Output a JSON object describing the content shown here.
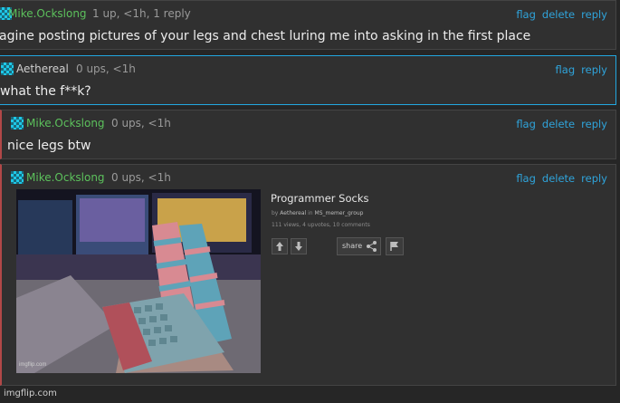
{
  "comments": [
    {
      "user": "Mike.Ockslong",
      "meta": "1 up, <1h, 1 reply",
      "actions": [
        "flag",
        "delete",
        "reply"
      ],
      "text": "agine posting pictures of your legs and chest luring me into asking in the first place"
    },
    {
      "user": "Aethereal",
      "meta": "0 ups, <1h",
      "actions": [
        "flag",
        "reply"
      ],
      "text": "what the f**k?"
    },
    {
      "user": "Mike.Ockslong",
      "meta": "0 ups, <1h",
      "actions": [
        "flag",
        "delete",
        "reply"
      ],
      "text": "nice legs btw"
    },
    {
      "user": "Mike.Ockslong",
      "meta": "0 ups, <1h",
      "actions": [
        "flag",
        "delete",
        "reply"
      ]
    }
  ],
  "embed": {
    "title": "Programmer Socks",
    "by_prefix": "by",
    "author": "Aethereal",
    "in_word": "in",
    "stream": "MS_memer_group",
    "stats": "111 views, 4 upvotes, 10 comments",
    "share_label": "share",
    "watermark": "imgflip.com"
  },
  "footer": {
    "watermark": "imgflip.com"
  },
  "colors": {
    "background": "#262626",
    "card": "#303030",
    "username": "#5cc15c",
    "link": "#2fa4db",
    "highlight_border": "#22a7e0"
  }
}
